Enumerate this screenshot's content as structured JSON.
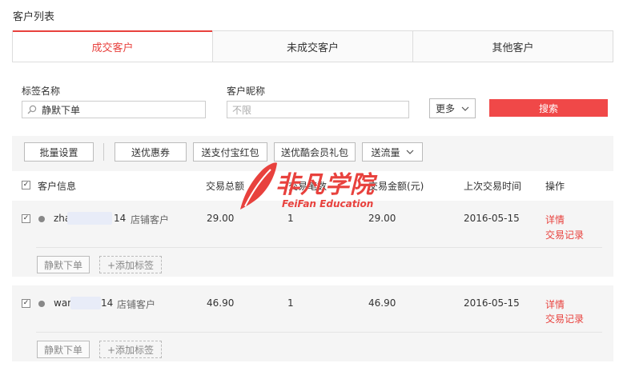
{
  "page_title": "客户列表",
  "tabs": [
    {
      "label": "成交客户",
      "active": true
    },
    {
      "label": "未成交客户",
      "active": false
    },
    {
      "label": "其他客户",
      "active": false
    }
  ],
  "filters": {
    "tag_label": "标签名称",
    "tag_value": "静默下单",
    "nickname_label": "客户昵称",
    "nickname_placeholder": "不限",
    "more_label": "更多",
    "search_label": "搜索"
  },
  "toolbar": {
    "batch_label": "批量设置",
    "coupon_label": "送优惠券",
    "alipay_label": "送支付宝红包",
    "member_gift_label": "送优酷会员礼包",
    "traffic_label": "送流量"
  },
  "table": {
    "columns": [
      "客户信息",
      "交易总额",
      "交易笔数",
      "交易金额(元)",
      "上次交易时间",
      "操作"
    ],
    "rows": [
      {
        "name_start": "zha",
        "name_end": "14",
        "type": "店铺客户",
        "total": "29.00",
        "count": "1",
        "amount": "29.00",
        "last_date": "2016-05-15",
        "detail": "详情",
        "records": "交易记录",
        "tag": "静默下单",
        "add_tag": "+添加标签"
      },
      {
        "name_start": "wan",
        "name_end": "14",
        "type": "店铺客户",
        "total": "46.90",
        "count": "1",
        "amount": "46.90",
        "last_date": "2016-05-15",
        "detail": "详情",
        "records": "交易记录",
        "tag": "静默下单",
        "add_tag": "+添加标签"
      }
    ]
  },
  "watermark": {
    "main": "非凡学院",
    "sub": "FeiFan Education"
  },
  "colors": {
    "accent": "#e8413d",
    "search_button": "#f04848"
  },
  "icons": [
    "search-icon",
    "chevron-down-icon",
    "checkbox-checked-icon",
    "user-dot-icon",
    "feather-logo-icon"
  ]
}
